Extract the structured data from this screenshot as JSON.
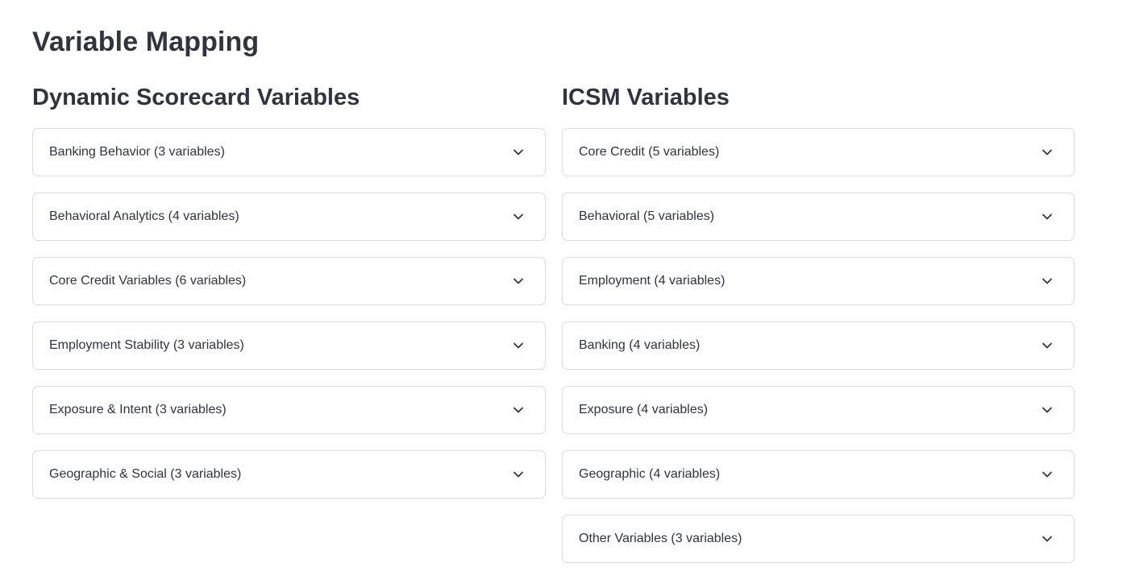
{
  "page": {
    "title": "Variable Mapping"
  },
  "left": {
    "title": "Dynamic Scorecard Variables",
    "items": [
      {
        "label": "Banking Behavior (3 variables)"
      },
      {
        "label": "Behavioral Analytics (4 variables)"
      },
      {
        "label": "Core Credit Variables (6 variables)"
      },
      {
        "label": "Employment Stability (3 variables)"
      },
      {
        "label": "Exposure & Intent (3 variables)"
      },
      {
        "label": "Geographic & Social (3 variables)"
      }
    ]
  },
  "right": {
    "title": "ICSM Variables",
    "items": [
      {
        "label": "Core Credit (5 variables)"
      },
      {
        "label": "Behavioral (5 variables)"
      },
      {
        "label": "Employment (4 variables)"
      },
      {
        "label": "Banking (4 variables)"
      },
      {
        "label": "Exposure (4 variables)"
      },
      {
        "label": "Geographic (4 variables)"
      },
      {
        "label": "Other Variables (3 variables)"
      }
    ]
  },
  "icons": {
    "expander": "chevron-down-icon"
  },
  "colors": {
    "text": "#31333f",
    "border": "#d9dbe0",
    "background": "#ffffff"
  }
}
